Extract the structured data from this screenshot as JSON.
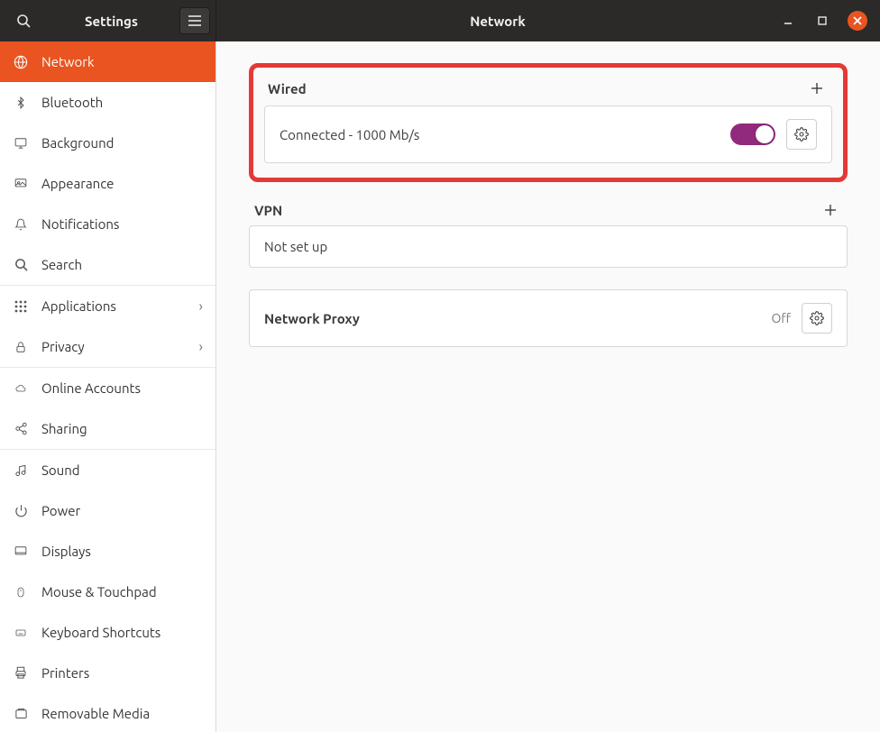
{
  "titlebar": {
    "app_title": "Settings",
    "page_title": "Network"
  },
  "sidebar": {
    "items": [
      {
        "label": "Network",
        "icon": "globe",
        "active": true
      },
      {
        "label": "Bluetooth",
        "icon": "bluetooth"
      },
      {
        "label": "Background",
        "icon": "monitor"
      },
      {
        "label": "Appearance",
        "icon": "appearance"
      },
      {
        "label": "Notifications",
        "icon": "bell"
      },
      {
        "label": "Search",
        "icon": "search"
      },
      {
        "label": "Applications",
        "icon": "grid",
        "chevron": true,
        "sep_before": true
      },
      {
        "label": "Privacy",
        "icon": "lock",
        "chevron": true
      },
      {
        "label": "Online Accounts",
        "icon": "cloud",
        "sep_before": true
      },
      {
        "label": "Sharing",
        "icon": "share"
      },
      {
        "label": "Sound",
        "icon": "sound",
        "sep_before": true
      },
      {
        "label": "Power",
        "icon": "power"
      },
      {
        "label": "Displays",
        "icon": "displays"
      },
      {
        "label": "Mouse & Touchpad",
        "icon": "mouse"
      },
      {
        "label": "Keyboard Shortcuts",
        "icon": "keyboard"
      },
      {
        "label": "Printers",
        "icon": "printer"
      },
      {
        "label": "Removable Media",
        "icon": "media"
      }
    ]
  },
  "main": {
    "wired": {
      "heading": "Wired",
      "status": "Connected - 1000 Mb/s",
      "enabled": true
    },
    "vpn": {
      "heading": "VPN",
      "status": "Not set up"
    },
    "proxy": {
      "label": "Network Proxy",
      "state": "Off"
    }
  }
}
